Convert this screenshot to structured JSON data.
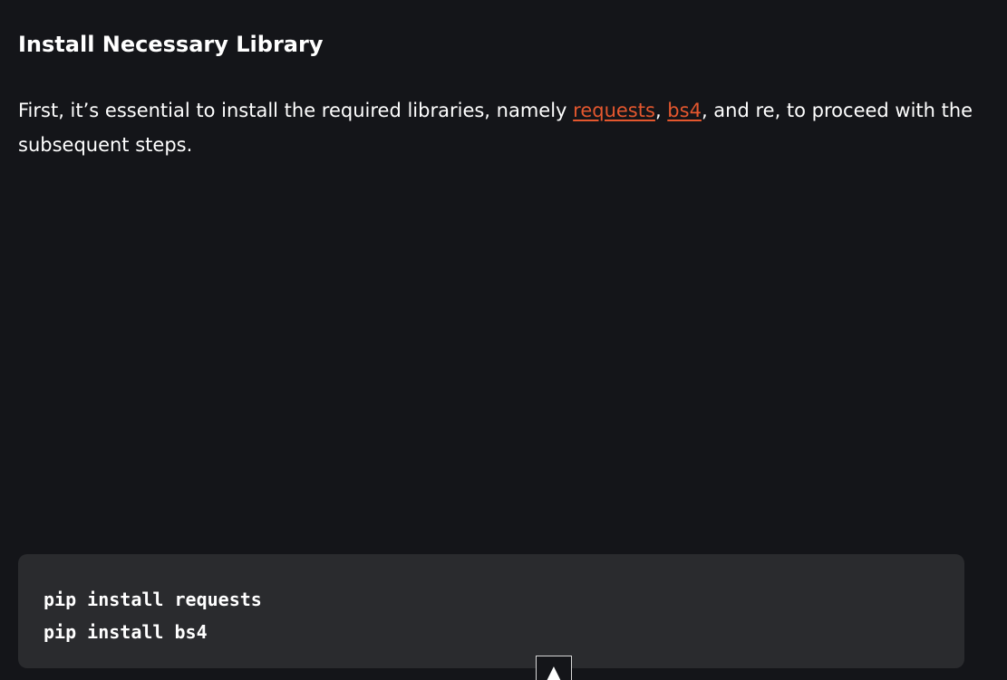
{
  "heading": "Install Necessary Library",
  "paragraph": {
    "text_before": "First, it’s essential to install the required libraries, namely ",
    "link_requests": "requests",
    "sep1": ", ",
    "link_bs4": "bs4",
    "text_after": ", and re, to proceed with the subsequent steps."
  },
  "code": {
    "lines": [
      "pip install requests",
      "pip install bs4"
    ]
  },
  "scroll_top": {
    "icon": "▲"
  },
  "colors": {
    "background": "#141519",
    "link": "#e4572e",
    "code_background": "#2a2b2e"
  }
}
